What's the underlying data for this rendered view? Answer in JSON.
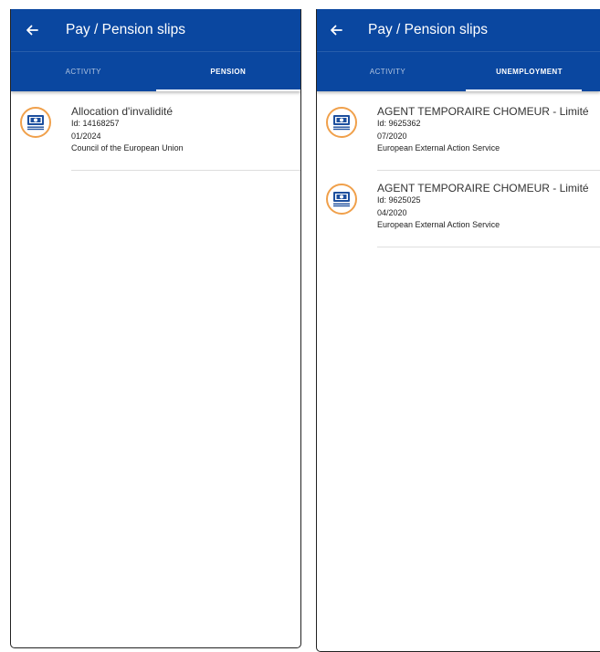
{
  "left": {
    "title": "Pay / Pension slips",
    "tabs": [
      "ACTIVITY",
      "PENSION"
    ],
    "active_tab": 1,
    "items": [
      {
        "name": "Allocation d'invalidité",
        "id": "Id: 14168257",
        "date": "01/2024",
        "org": "Council of the European Union"
      }
    ]
  },
  "right": {
    "title": "Pay / Pension slips",
    "tabs": [
      "ACTIVITY",
      "UNEMPLOYMENT"
    ],
    "active_tab": 1,
    "items": [
      {
        "name": "AGENT TEMPORAIRE CHOMEUR - Limité",
        "id": "Id: 9625362",
        "date": "07/2020",
        "org": "European External Action Service"
      },
      {
        "name": "AGENT TEMPORAIRE CHOMEUR - Limité",
        "id": "Id: 9625025",
        "date": "04/2020",
        "org": "European External Action Service"
      }
    ]
  },
  "colors": {
    "appbar": "#0a47a0",
    "icon_ring": "#f0a04b",
    "icon": "#1d4f9e"
  },
  "icons": {
    "back": "arrow-left-icon",
    "item": "money-bill-icon"
  }
}
